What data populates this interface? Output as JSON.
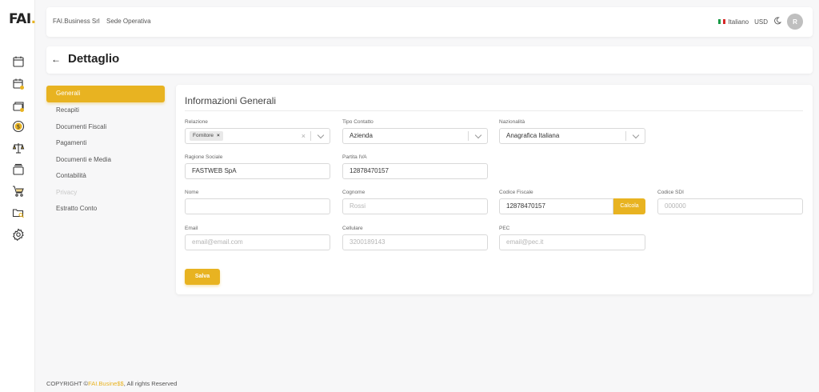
{
  "app": {
    "logo_text": "FAI",
    "logo_dot": ".",
    "accent": "#e8b321"
  },
  "rail": {
    "icons": [
      "calendar-icon",
      "calendar-check-icon",
      "cards-icon",
      "dollar-circle-icon",
      "scales-icon",
      "archive-icon",
      "cart-icon",
      "folder-search-icon",
      "settings-gear-icon"
    ]
  },
  "header": {
    "company": "FAI.Business Srl",
    "location": "Sede Operativa",
    "language": "Italiano",
    "currency": "USD",
    "avatar_initial": "R"
  },
  "page": {
    "title": "Dettaglio"
  },
  "side_menu": {
    "items": [
      {
        "label": "Generali",
        "state": "active"
      },
      {
        "label": "Recapiti",
        "state": "normal"
      },
      {
        "label": "Documenti Fiscali",
        "state": "normal"
      },
      {
        "label": "Pagamenti",
        "state": "normal"
      },
      {
        "label": "Documenti e Media",
        "state": "normal"
      },
      {
        "label": "Contabilità",
        "state": "normal"
      },
      {
        "label": "Privacy",
        "state": "disabled"
      },
      {
        "label": "Estratto Conto",
        "state": "normal"
      }
    ]
  },
  "form": {
    "title": "Informazioni Generali",
    "relazione": {
      "label": "Relazione",
      "chip": "Fornitore",
      "chip_remove": "×",
      "clear": "×"
    },
    "tipo_contatto": {
      "label": "Tipo Contatto",
      "value": "Azienda"
    },
    "nazionalita": {
      "label": "Nazionalità",
      "value": "Anagrafica Italiana"
    },
    "ragione_sociale": {
      "label": "Ragione Sociale",
      "value": "FASTWEB SpA"
    },
    "partita_iva": {
      "label": "Partita IVA",
      "value": "12878470157"
    },
    "nome": {
      "label": "Nome",
      "value": ""
    },
    "cognome": {
      "label": "Cognome",
      "placeholder": "Rossi"
    },
    "codice_fiscale": {
      "label": "Codice Fiscale",
      "value": "12878470157",
      "button": "Calcola"
    },
    "codice_sdi": {
      "label": "Codice SDI",
      "placeholder": "000000"
    },
    "email": {
      "label": "Email",
      "placeholder": "email@email.com"
    },
    "cellulare": {
      "label": "Cellulare",
      "placeholder": "3200189143"
    },
    "pec": {
      "label": "PEC",
      "placeholder": "email@pec.it"
    },
    "save_label": "Salva"
  },
  "footer": {
    "prefix": "COPYRIGHT ©",
    "brand": "FAI.Busine$$",
    "suffix": ", All rights Reserved"
  }
}
